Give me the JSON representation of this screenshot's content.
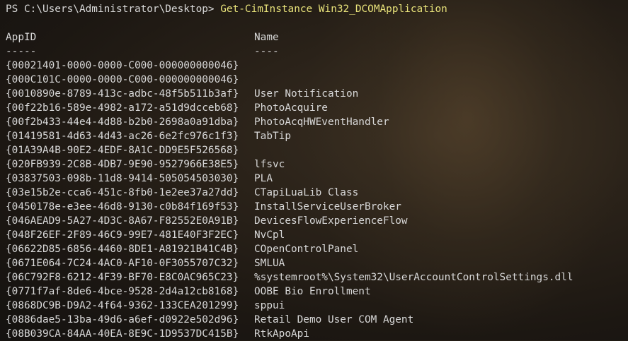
{
  "prompt": {
    "path": "PS C:\\Users\\Administrator\\Desktop> ",
    "command": "Get-CimInstance Win32_DCOMApplication"
  },
  "headers": {
    "appid": "AppID",
    "name": "Name",
    "appid_dash": "-----",
    "name_dash": "----"
  },
  "rows": [
    {
      "appid": "{00021401-0000-0000-C000-000000000046}",
      "name": ""
    },
    {
      "appid": "{000C101C-0000-0000-C000-000000000046}",
      "name": ""
    },
    {
      "appid": "{0010890e-8789-413c-adbc-48f5b511b3af}",
      "name": "User Notification"
    },
    {
      "appid": "{00f22b16-589e-4982-a172-a51d9dcceb68}",
      "name": "PhotoAcquire"
    },
    {
      "appid": "{00f2b433-44e4-4d88-b2b0-2698a0a91dba}",
      "name": "PhotoAcqHWEventHandler"
    },
    {
      "appid": "{01419581-4d63-4d43-ac26-6e2fc976c1f3}",
      "name": "TabTip"
    },
    {
      "appid": "{01A39A4B-90E2-4EDF-8A1C-DD9E5F526568}",
      "name": ""
    },
    {
      "appid": "{020FB939-2C8B-4DB7-9E90-9527966E38E5}",
      "name": "lfsvc"
    },
    {
      "appid": "{03837503-098b-11d8-9414-505054503030}",
      "name": "PLA"
    },
    {
      "appid": "{03e15b2e-cca6-451c-8fb0-1e2ee37a27dd}",
      "name": "CTapiLuaLib Class"
    },
    {
      "appid": "{0450178e-e3ee-46d8-9130-c0b84f169f53}",
      "name": "InstallServiceUserBroker"
    },
    {
      "appid": "{046AEAD9-5A27-4D3C-8A67-F82552E0A91B}",
      "name": "DevicesFlowExperienceFlow"
    },
    {
      "appid": "{048F26EF-2F89-46C9-99E7-481E40F3F2EC}",
      "name": "NvCpl"
    },
    {
      "appid": "{06622D85-6856-4460-8DE1-A81921B41C4B}",
      "name": "COpenControlPanel"
    },
    {
      "appid": "{0671E064-7C24-4AC0-AF10-0F3055707C32}",
      "name": "SMLUA"
    },
    {
      "appid": "{06C792F8-6212-4F39-BF70-E8C0AC965C23}",
      "name": "%systemroot%\\System32\\UserAccountControlSettings.dll"
    },
    {
      "appid": "{0771f7af-8de6-4bce-9528-2d4a12cb8168}",
      "name": "OOBE Bio Enrollment"
    },
    {
      "appid": "{0868DC9B-D9A2-4f64-9362-133CEA201299}",
      "name": "sppui"
    },
    {
      "appid": "{0886dae5-13ba-49d6-a6ef-d0922e502d96}",
      "name": "Retail Demo User COM Agent"
    },
    {
      "appid": "{08B039CA-84AA-40EA-8E9C-1D9537DC415B}",
      "name": "RtkApoApi"
    }
  ],
  "colors": {
    "background": "#1c1712",
    "text": "#d8d8d8",
    "command": "#e8e27a"
  }
}
